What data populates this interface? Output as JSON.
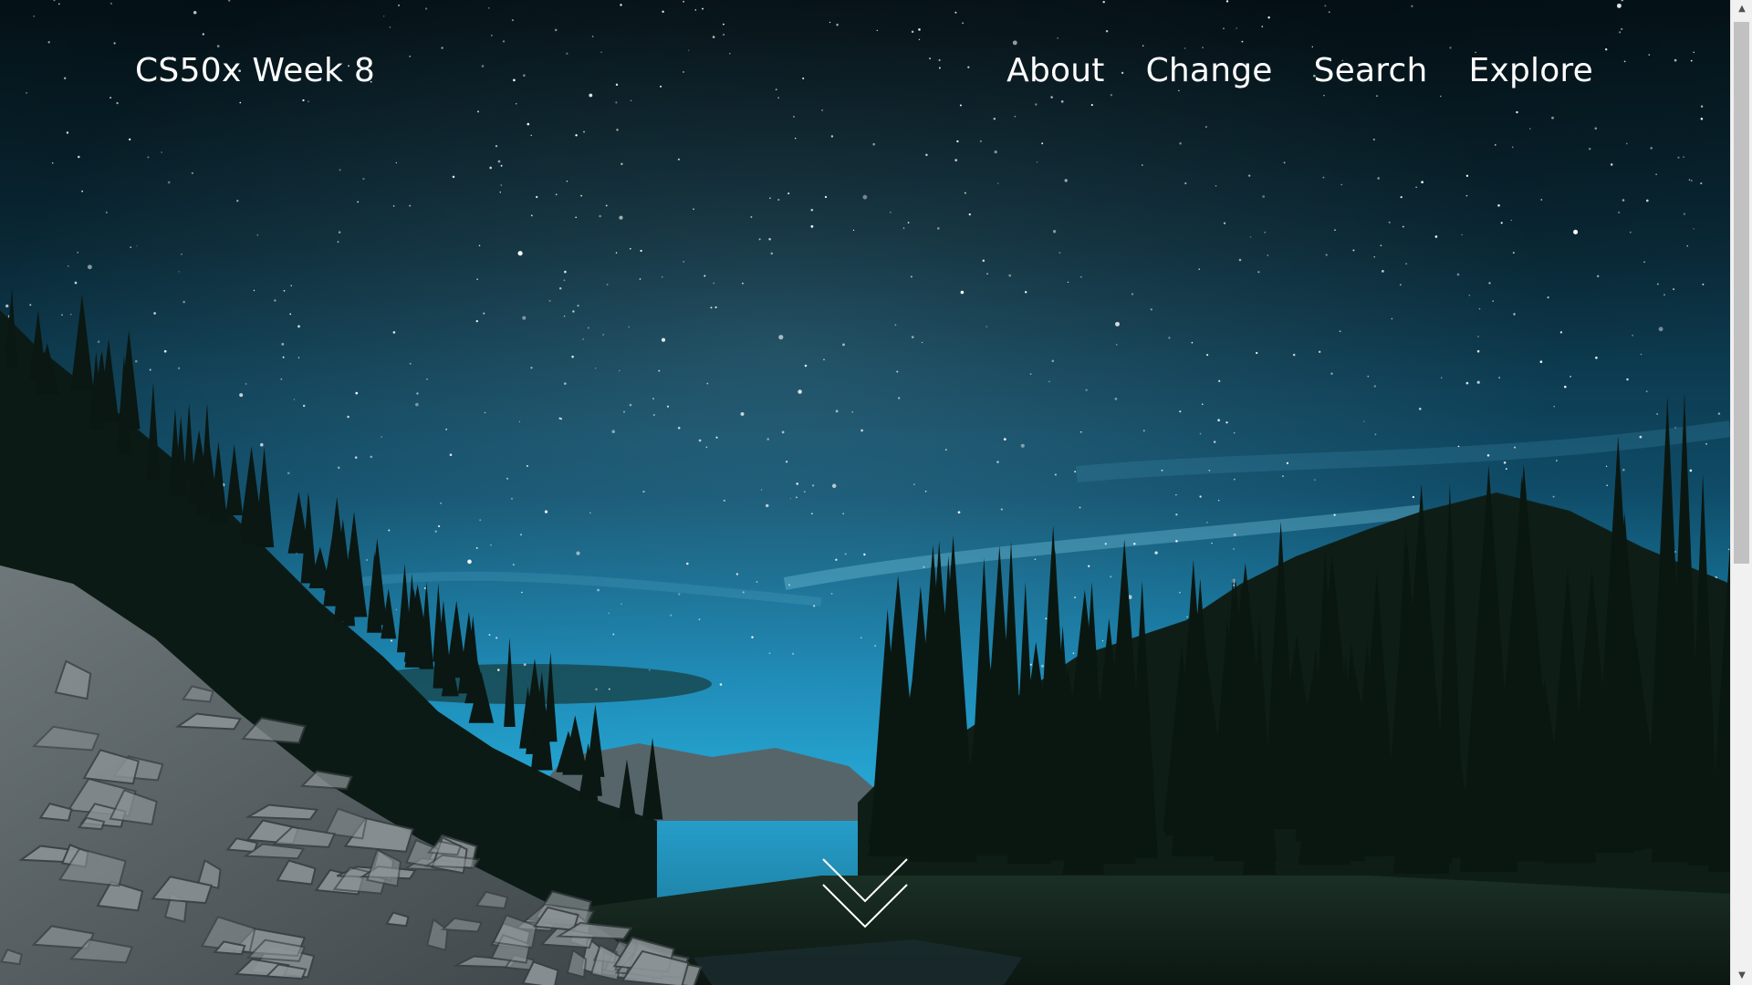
{
  "header": {
    "brand": "CS50x Week 8",
    "nav": [
      {
        "label": "About"
      },
      {
        "label": "Change"
      },
      {
        "label": "Search"
      },
      {
        "label": "Explore"
      }
    ]
  },
  "hero": {
    "background": "night-sky-forest-photo",
    "scroll_icon": "double-chevron-down-icon"
  },
  "colors": {
    "sky_top": "#06161d",
    "sky_horizon": "#1b8bb8",
    "text": "#ffffff",
    "forest": "#0b1a14"
  },
  "scrollbar": {
    "position_fraction": 0
  }
}
